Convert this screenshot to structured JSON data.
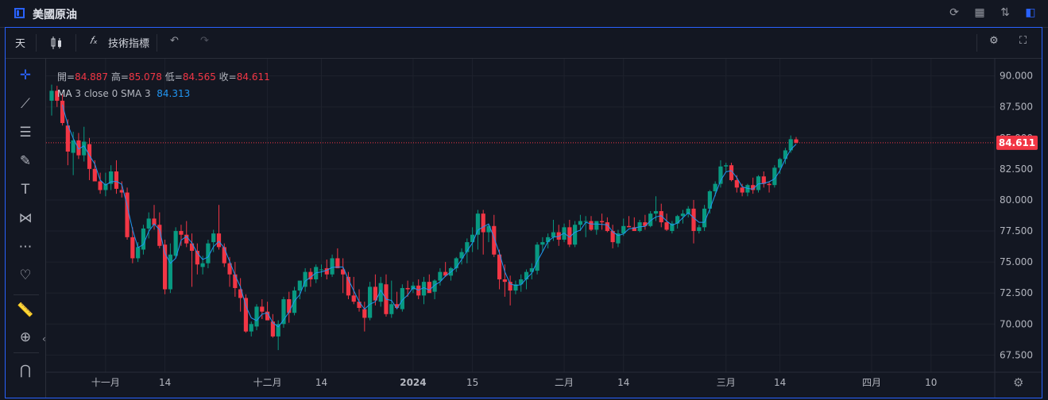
{
  "window": {
    "title": "美國原油"
  },
  "toolbar": {
    "interval": "天",
    "indicators_label": "技術指標"
  },
  "legend": {
    "open_label": "開=",
    "open": "84.887",
    "high_label": "高=",
    "high": "85.078",
    "low_label": "低=",
    "low": "84.565",
    "close_label": "收=",
    "close": "84.611",
    "ma_name": "MA",
    "ma_params": "3 close 0 SMA 3",
    "ma_value": "84.313"
  },
  "colors": {
    "up": "#089981",
    "down": "#f23645",
    "ma": "#2196f3",
    "background": "#131722",
    "grid": "#1e222d"
  },
  "chart_data": {
    "type": "candlestick",
    "ylim": [
      66.5,
      91.0
    ],
    "y_ticks": [
      "90.000",
      "87.500",
      "85.000",
      "82.500",
      "80.000",
      "77.500",
      "75.000",
      "72.500",
      "70.000",
      "67.500"
    ],
    "x_ticks": [
      "十一月",
      "14",
      "十二月",
      "14",
      "2024",
      "15",
      "二月",
      "14",
      "三月",
      "14",
      "四月",
      "10"
    ],
    "x_tick_index": [
      10,
      21,
      40,
      50,
      67,
      78,
      95,
      106,
      125,
      135,
      152,
      163
    ],
    "last_price": "84.611",
    "series": [
      {
        "name": "MA 3 close 0 SMA 3"
      }
    ],
    "ohlc": [
      [
        88.0,
        89.3,
        86.8,
        88.8
      ],
      [
        88.8,
        89.2,
        87.5,
        88.0
      ],
      [
        88.0,
        88.5,
        86.0,
        86.2
      ],
      [
        86.0,
        86.5,
        82.8,
        83.9
      ],
      [
        83.8,
        85.5,
        82.0,
        84.8
      ],
      [
        84.8,
        85.4,
        83.3,
        83.6
      ],
      [
        83.6,
        85.9,
        83.1,
        84.7
      ],
      [
        84.5,
        85.0,
        81.6,
        82.5
      ],
      [
        82.5,
        83.2,
        81.5,
        81.5
      ],
      [
        81.5,
        82.2,
        80.5,
        80.8
      ],
      [
        80.8,
        82.2,
        80.3,
        81.3
      ],
      [
        81.3,
        82.8,
        80.8,
        82.3
      ],
      [
        82.3,
        83.2,
        80.5,
        80.9
      ],
      [
        80.8,
        81.5,
        80.2,
        80.6
      ],
      [
        80.6,
        81.0,
        76.8,
        77.0
      ],
      [
        77.0,
        77.8,
        74.9,
        75.3
      ],
      [
        75.3,
        76.6,
        75.0,
        76.2
      ],
      [
        76.0,
        78.0,
        75.6,
        77.7
      ],
      [
        77.7,
        79.0,
        76.9,
        78.5
      ],
      [
        78.5,
        79.6,
        77.6,
        78.0
      ],
      [
        78.0,
        79.0,
        76.1,
        76.3
      ],
      [
        76.4,
        76.8,
        72.4,
        72.8
      ],
      [
        72.8,
        76.5,
        72.5,
        75.6
      ],
      [
        75.5,
        77.8,
        75.3,
        77.5
      ],
      [
        77.5,
        78.0,
        76.3,
        77.2
      ],
      [
        77.2,
        78.3,
        76.2,
        76.5
      ],
      [
        76.5,
        77.3,
        73.0,
        75.9
      ],
      [
        75.9,
        76.5,
        74.0,
        74.8
      ],
      [
        74.6,
        75.5,
        74.0,
        74.9
      ],
      [
        74.9,
        76.8,
        74.5,
        76.5
      ],
      [
        76.6,
        77.6,
        75.8,
        77.3
      ],
      [
        77.3,
        79.6,
        76.0,
        76.2
      ],
      [
        76.2,
        76.5,
        74.6,
        74.9
      ],
      [
        74.9,
        75.4,
        73.0,
        74.0
      ],
      [
        74.0,
        75.0,
        72.2,
        72.9
      ],
      [
        72.8,
        73.7,
        71.0,
        72.1
      ],
      [
        72.1,
        72.4,
        69.3,
        69.4
      ],
      [
        69.4,
        70.2,
        69.0,
        70.0
      ],
      [
        69.8,
        71.6,
        69.5,
        71.4
      ],
      [
        71.4,
        72.0,
        70.4,
        71.0
      ],
      [
        71.0,
        71.8,
        70.4,
        70.3
      ],
      [
        70.2,
        70.8,
        68.9,
        69.0
      ],
      [
        69.0,
        70.3,
        67.9,
        70.0
      ],
      [
        70.0,
        72.2,
        69.7,
        72.0
      ],
      [
        72.0,
        72.6,
        70.1,
        70.9
      ],
      [
        70.9,
        73.0,
        70.7,
        72.7
      ],
      [
        72.7,
        73.2,
        72.0,
        73.5
      ],
      [
        73.0,
        74.5,
        72.6,
        74.2
      ],
      [
        74.2,
        74.5,
        73.0,
        73.6
      ],
      [
        73.6,
        74.8,
        73.3,
        74.6
      ],
      [
        74.4,
        74.8,
        73.8,
        74.4
      ],
      [
        74.5,
        75.2,
        73.6,
        74.0
      ],
      [
        74.0,
        75.6,
        73.8,
        75.3
      ],
      [
        75.3,
        76.1,
        74.5,
        74.5
      ],
      [
        74.4,
        75.3,
        72.5,
        74.0
      ],
      [
        73.8,
        74.2,
        72.0,
        72.3
      ],
      [
        72.3,
        73.8,
        71.6,
        71.8
      ],
      [
        71.8,
        72.8,
        71.0,
        71.3
      ],
      [
        71.2,
        71.8,
        69.4,
        70.5
      ],
      [
        70.5,
        73.4,
        70.3,
        73.0
      ],
      [
        73.0,
        74.0,
        71.5,
        71.9
      ],
      [
        71.8,
        73.8,
        71.4,
        73.3
      ],
      [
        73.2,
        74.0,
        70.6,
        70.8
      ],
      [
        70.8,
        73.5,
        70.5,
        71.6
      ],
      [
        71.6,
        72.6,
        71.2,
        71.3
      ],
      [
        71.2,
        73.2,
        71.0,
        72.9
      ],
      [
        72.9,
        73.5,
        72.2,
        72.8
      ],
      [
        72.8,
        73.4,
        72.5,
        73.1
      ],
      [
        73.1,
        73.6,
        72.0,
        72.3
      ],
      [
        72.3,
        73.8,
        71.6,
        73.4
      ],
      [
        73.4,
        74.0,
        72.7,
        72.5
      ],
      [
        72.6,
        73.6,
        72.0,
        73.5
      ],
      [
        73.5,
        74.5,
        73.1,
        74.2
      ],
      [
        74.2,
        75.0,
        73.8,
        73.9
      ],
      [
        73.9,
        74.6,
        73.5,
        74.5
      ],
      [
        74.5,
        75.4,
        74.2,
        75.3
      ],
      [
        75.3,
        76.1,
        74.8,
        75.8
      ],
      [
        75.8,
        76.9,
        74.9,
        76.6
      ],
      [
        76.6,
        77.8,
        75.8,
        77.2
      ],
      [
        77.2,
        79.2,
        76.0,
        78.9
      ],
      [
        78.9,
        79.2,
        75.6,
        77.4
      ],
      [
        77.4,
        78.1,
        76.6,
        77.9
      ],
      [
        77.9,
        78.8,
        75.4,
        75.6
      ],
      [
        75.6,
        76.0,
        72.8,
        73.6
      ],
      [
        73.6,
        74.8,
        72.2,
        73.4
      ],
      [
        73.4,
        73.9,
        71.5,
        72.7
      ],
      [
        72.7,
        73.5,
        72.4,
        73.2
      ],
      [
        73.2,
        74.0,
        72.6,
        73.6
      ],
      [
        73.6,
        74.4,
        72.8,
        74.2
      ],
      [
        74.2,
        74.9,
        73.6,
        74.5
      ],
      [
        74.3,
        76.6,
        74.0,
        76.4
      ],
      [
        76.4,
        77.0,
        75.8,
        76.6
      ],
      [
        76.6,
        77.3,
        76.1,
        77.0
      ],
      [
        77.0,
        78.4,
        76.7,
        77.4
      ],
      [
        77.4,
        78.0,
        76.3,
        76.8
      ],
      [
        76.8,
        78.1,
        76.6,
        77.8
      ],
      [
        77.8,
        78.4,
        76.2,
        76.4
      ],
      [
        76.4,
        78.3,
        76.2,
        78.0
      ],
      [
        78.0,
        78.8,
        77.5,
        78.3
      ],
      [
        78.3,
        78.7,
        77.0,
        78.3
      ],
      [
        78.3,
        78.7,
        77.5,
        77.6
      ],
      [
        77.6,
        78.3,
        77.2,
        78.3
      ],
      [
        78.3,
        78.9,
        77.6,
        78.2
      ],
      [
        78.2,
        78.6,
        77.4,
        77.5
      ],
      [
        77.5,
        78.0,
        76.1,
        76.6
      ],
      [
        76.5,
        77.6,
        76.2,
        77.3
      ],
      [
        77.3,
        78.5,
        77.1,
        77.9
      ],
      [
        77.9,
        78.7,
        77.8,
        77.8
      ],
      [
        77.8,
        78.6,
        77.5,
        77.5
      ],
      [
        77.5,
        78.4,
        77.4,
        78.2
      ],
      [
        78.2,
        78.8,
        77.6,
        77.9
      ],
      [
        77.9,
        79.1,
        77.8,
        78.9
      ],
      [
        78.9,
        80.3,
        78.3,
        79.1
      ],
      [
        79.1,
        79.7,
        77.8,
        78.2
      ],
      [
        78.2,
        78.9,
        77.5,
        77.6
      ],
      [
        77.5,
        78.3,
        77.3,
        78.1
      ],
      [
        78.1,
        78.8,
        77.7,
        78.7
      ],
      [
        78.7,
        79.2,
        78.1,
        78.9
      ],
      [
        78.9,
        79.5,
        78.6,
        79.3
      ],
      [
        79.3,
        80.0,
        76.5,
        77.5
      ],
      [
        77.5,
        78.0,
        77.3,
        77.8
      ],
      [
        77.8,
        79.6,
        77.5,
        79.3
      ],
      [
        79.3,
        80.8,
        78.9,
        80.7
      ],
      [
        80.7,
        81.5,
        80.3,
        81.3
      ],
      [
        81.3,
        83.2,
        81.0,
        82.7
      ],
      [
        82.7,
        83.0,
        82.3,
        82.8
      ],
      [
        82.8,
        83.0,
        81.5,
        81.6
      ],
      [
        81.6,
        82.0,
        80.6,
        81.0
      ],
      [
        81.0,
        81.3,
        80.3,
        80.6
      ],
      [
        80.6,
        81.3,
        80.3,
        81.2
      ],
      [
        81.2,
        81.8,
        80.5,
        80.8
      ],
      [
        80.8,
        82.0,
        80.6,
        81.9
      ],
      [
        81.9,
        82.3,
        81.0,
        81.3
      ],
      [
        81.3,
        81.5,
        80.6,
        81.2
      ],
      [
        81.2,
        82.8,
        81.0,
        82.6
      ],
      [
        82.6,
        83.4,
        82.1,
        83.3
      ],
      [
        83.3,
        84.2,
        82.9,
        84.0
      ],
      [
        84.0,
        85.2,
        83.8,
        84.9
      ],
      [
        84.887,
        85.078,
        84.565,
        84.611
      ]
    ]
  },
  "left_tools": [
    "crosshair-icon",
    "trendline-icon",
    "fib-icon",
    "brush-icon",
    "text-icon",
    "pattern-icon",
    "forecast-icon",
    "heart-icon",
    "ruler-icon",
    "zoom-icon",
    "magnet-icon"
  ]
}
